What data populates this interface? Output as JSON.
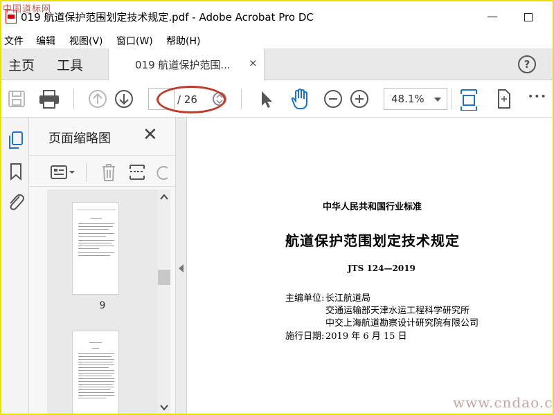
{
  "window": {
    "title": "019 航道保护范围划定技术规定.pdf - Adobe Acrobat Pro DC",
    "watermark_top": "中国道标网",
    "minimize_glyph": "—"
  },
  "menu": [
    "文件",
    "编辑",
    "视图(V)",
    "窗口(W)",
    "帮助(H)"
  ],
  "tabs": {
    "home": "主页",
    "tools": "工具",
    "document": "019 航道保护范围...",
    "close_glyph": "×",
    "help_glyph": "?"
  },
  "toolbar": {
    "page_current": "",
    "page_total": "/ 26",
    "zoom": "48.1%",
    "more_glyph": "•••"
  },
  "panel": {
    "title": "页面缩略图",
    "close_glyph": "✕",
    "thumbs": [
      {
        "label": "9"
      },
      {
        "label": ""
      }
    ]
  },
  "document": {
    "standard_category": "中华人民共和国行业标准",
    "title": "航道保护范围划定技术规定",
    "code": "JTS 124—2019",
    "editors_label": "主编单位:",
    "editors": [
      "长江航道局",
      "交通运输部天津水运工程科学研究所",
      "中交上海航道勘察设计研究院有限公司"
    ],
    "effective_label": "施行日期:",
    "effective_date": "2019 年 6 月 15 日"
  },
  "watermark_bottom": "www.cndao.com",
  "colors": {
    "highlight_border": "#e8e000",
    "annotation_ellipse": "#c0392b",
    "accent_blue": "#1a73c8",
    "pdf_red": "#d40000"
  },
  "icons": [
    "save-icon",
    "print-icon",
    "page-up-icon",
    "page-down-icon",
    "select-arrow-icon",
    "hand-icon",
    "zoom-out-icon",
    "zoom-in-icon",
    "fit-page-icon",
    "rotate-view-icon",
    "more-icon",
    "pages-icon",
    "bookmark-icon",
    "attachment-icon",
    "thumb-options-icon",
    "delete-icon",
    "insert-page-icon",
    "rotate-icon"
  ]
}
